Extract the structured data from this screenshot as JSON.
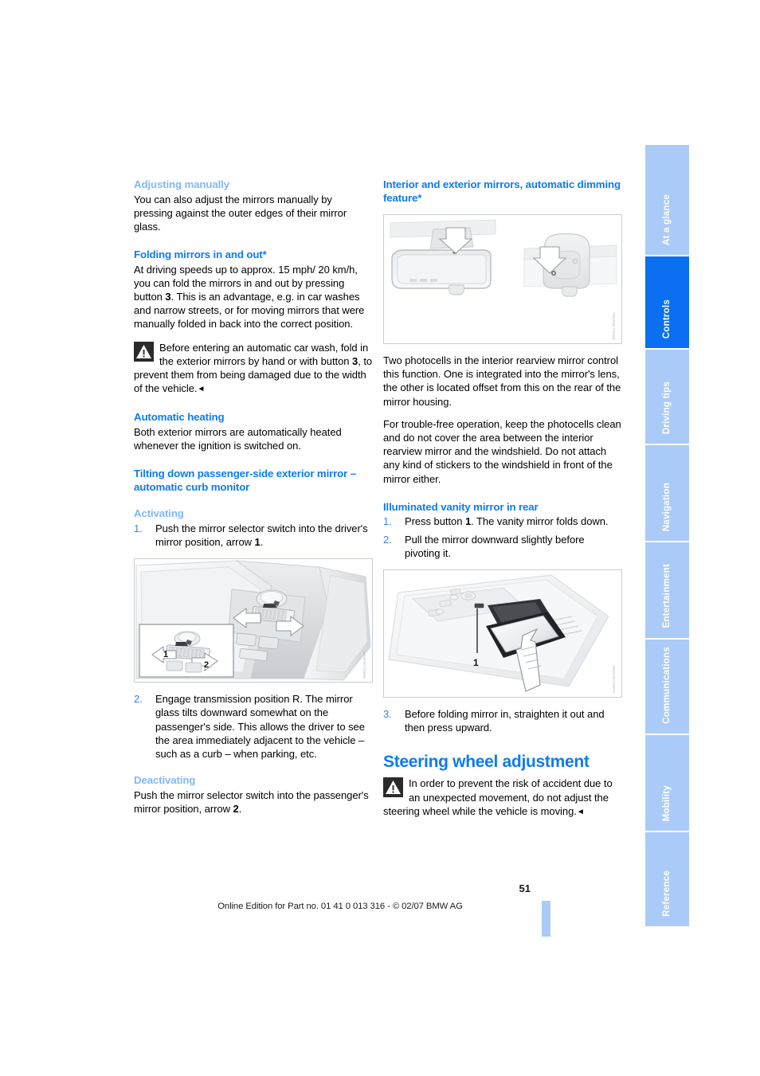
{
  "document": {
    "page_number": "51",
    "footer_text": "Online Edition for Part no. 01 41 0 013 316 - © 02/07 BMW AG"
  },
  "index_tabs": [
    {
      "label": "At a glance",
      "active": false
    },
    {
      "label": "Controls",
      "active": true
    },
    {
      "label": "Driving tips",
      "active": false
    },
    {
      "label": "Navigation",
      "active": false
    },
    {
      "label": "Entertainment",
      "active": false
    },
    {
      "label": "Communications",
      "active": false
    },
    {
      "label": "Mobility",
      "active": false
    },
    {
      "label": "Reference",
      "active": false
    }
  ],
  "left_column": {
    "s1": {
      "heading": "Adjusting manually",
      "p1": "You can also adjust the mirrors manually by pressing against the outer edges of their mirror glass."
    },
    "s2": {
      "heading": "Folding mirrors in and out*",
      "p1_a": "At driving speeds up to approx. 15 mph/ 20 km/h, you can fold the mirrors in and out by pressing button ",
      "p1_bold": "3",
      "p1_b": ". This is an advantage, e.g. in car washes and narrow streets, or for moving mirrors that were manually folded in back into the correct position.",
      "warning_a": "Before entering an automatic car wash, fold in the exterior mirrors by hand or with button ",
      "warning_bold": "3",
      "warning_b": ", to prevent them from being damaged due to the width of the vehicle.",
      "warning_endmark": "◄"
    },
    "s3": {
      "heading": "Automatic heating",
      "p1": "Both exterior mirrors are automatically heated whenever the ignition is switched on."
    },
    "s4": {
      "heading": "Tilting down passenger-side exterior mirror – automatic curb monitor",
      "sub_activating": "Activating",
      "step1_num": "1.",
      "step1_a": "Push the mirror selector switch into the driver's mirror position, arrow ",
      "step1_bold": "1",
      "step1_b": ".",
      "figure_credit": "MIR01LSD4FMA",
      "figure_callout_1": "1",
      "figure_callout_2": "2",
      "step2_num": "2.",
      "step2": "Engage transmission position R. The mirror glass tilts downward somewhat on the passenger's side. This allows the driver to see the area immediately adjacent to the vehicle – such as a curb – when parking, etc.",
      "sub_deactivating": "Deactivating",
      "p_deact_a": "Push the mirror selector switch into the passenger's mirror position, arrow ",
      "p_deact_bold": "2",
      "p_deact_b": "."
    }
  },
  "right_column": {
    "s1": {
      "heading": "Interior and exterior mirrors, automatic dimming feature*",
      "figure_credit": "MIR01LSD4FMA",
      "p1": "Two photocells in the interior rearview mirror control this function. One is integrated into the mirror's lens, the other is located offset from this on the rear of the mirror housing.",
      "p2": "For trouble-free operation, keep the photocells clean and do not cover the area between the interior rearview mirror and the windshield. Do not attach any kind of stickers to the windshield in front of the mirror either."
    },
    "s2": {
      "heading": "Illuminated vanity mirror in rear",
      "step1_num": "1.",
      "step1_a": "Press button ",
      "step1_bold": "1",
      "step1_b": ". The vanity mirror folds down.",
      "step2_num": "2.",
      "step2": "Pull the mirror downward slightly before pivoting it.",
      "figure_credit": "VAN01LSD4FMA",
      "figure_callout_1": "1",
      "step3_num": "3.",
      "step3": "Before folding mirror in, straighten it out and then press upward."
    },
    "s3": {
      "heading": "Steering wheel adjustment",
      "warning_a": "In order to prevent the risk of accident due to an unexpected movement, do not adjust the steering wheel while the vehicle is moving.",
      "warning_endmark": "◄"
    }
  },
  "colors": {
    "heading_blue": "#0d7bf2",
    "subheading_blue": "#82b8f5",
    "tab_blue": "#aacbf7",
    "tab_active_blue": "#0a6ff0",
    "list_number_blue": "#2f86f0"
  }
}
